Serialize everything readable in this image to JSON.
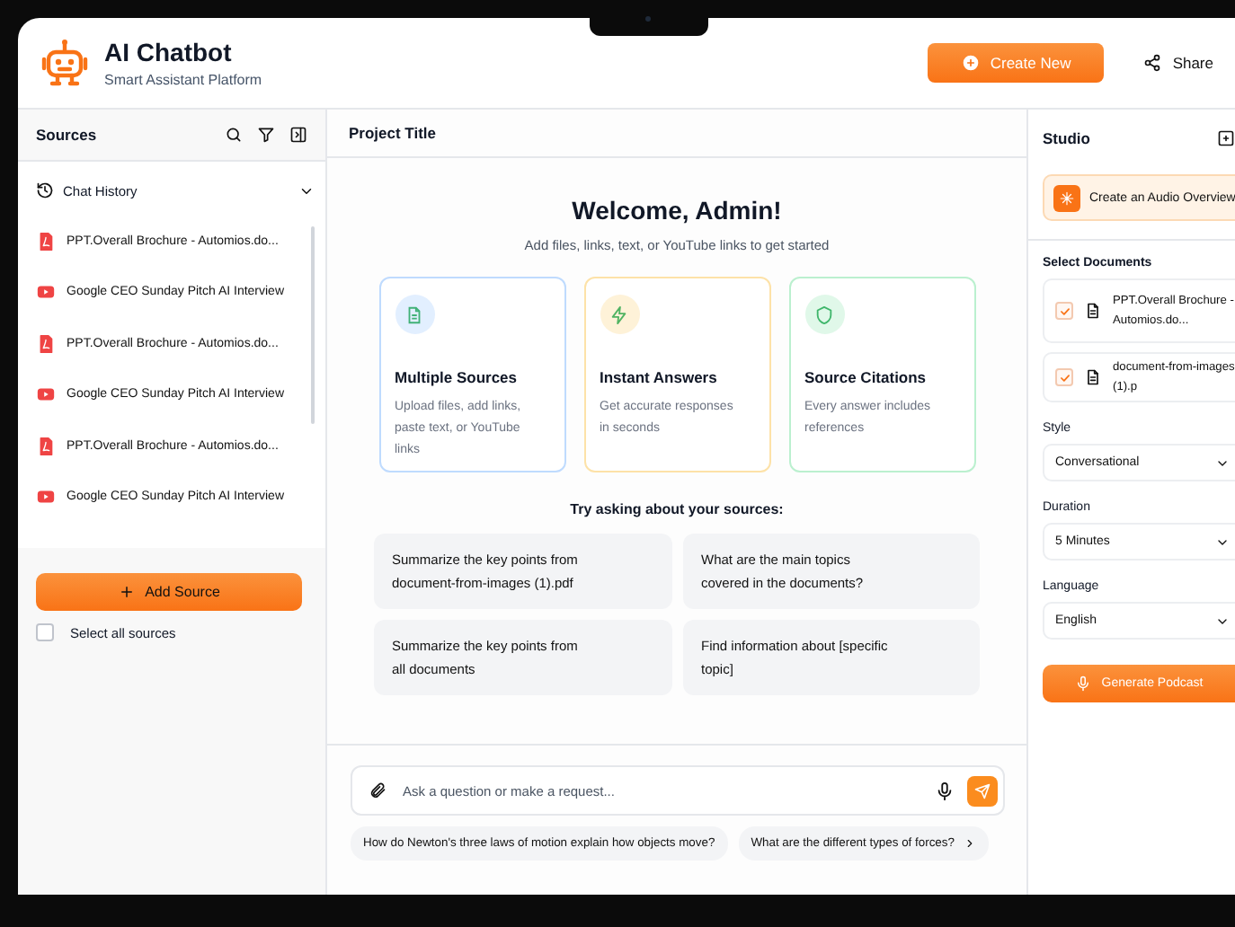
{
  "app": {
    "title": "AI Chatbot",
    "subtitle": "Smart Assistant Platform"
  },
  "header_actions": [
    {
      "kind": "primary",
      "label": "Create New"
    },
    {
      "kind": "plain",
      "label": "Share"
    }
  ],
  "sources_panel": {
    "title": "Sources",
    "section": {
      "label": "Chat History",
      "expanded": true
    },
    "items": [
      {
        "kind": "pdf",
        "label": "PPT.Overall Brochure - Automios.do..."
      },
      {
        "kind": "video",
        "label": "Google CEO Sunday Pitch AI Interview"
      },
      {
        "kind": "pdf",
        "label": "PPT.Overall Brochure - Automios.do..."
      },
      {
        "kind": "video",
        "label": "Google CEO Sunday Pitch AI Interview"
      },
      {
        "kind": "pdf",
        "label": "PPT.Overall Brochure - Automios.do..."
      },
      {
        "kind": "video",
        "label": "Google CEO Sunday Pitch AI Interview"
      }
    ],
    "add_button": "Add Source",
    "select_all": {
      "label": "Select all sources",
      "checked": false
    }
  },
  "main": {
    "title": "Project Title",
    "welcome": "Welcome, Admin!",
    "subtitle": "Add files, links, text, or YouTube links to get started",
    "features": [
      {
        "kind": "document",
        "color": "#bfdbfe",
        "title": "Multiple Sources",
        "text": "Upload files, add links, paste text, or YouTube links"
      },
      {
        "kind": "bolt",
        "color": "#fde2a8",
        "title": "Instant Answers",
        "text": "Get accurate responses in seconds"
      },
      {
        "kind": "shield",
        "color": "#bbf0cf",
        "title": "Source Citations",
        "text": "Every answer includes references"
      }
    ],
    "suggestions_title": "Try asking about your sources:",
    "suggestions": [
      "Summarize the key points from document-from-images (1).pdf",
      "What are the main topics covered in the documents?",
      "Summarize the key points from all documents",
      "Find information about [specific topic]"
    ],
    "input": {
      "placeholder": "Ask a question or make a request..."
    },
    "quick_questions": [
      "How do Newton's three laws of motion explain how objects move?",
      "What are the different types of forces?"
    ]
  },
  "studio": {
    "title": "Studio",
    "audio_overview": "Create an Audio Overview",
    "documents_label": "Select Documents",
    "documents": [
      {
        "label": "PPT.Overall Brochure - Automios.do...",
        "checked": true
      },
      {
        "label": "document-from-images (1).p",
        "checked": true
      }
    ],
    "fields": [
      {
        "label": "Style",
        "value": "Conversational"
      },
      {
        "label": "Duration",
        "value": "5 Minutes"
      },
      {
        "label": "Language",
        "value": "English"
      }
    ],
    "generate_button": "Generate Podcast"
  }
}
